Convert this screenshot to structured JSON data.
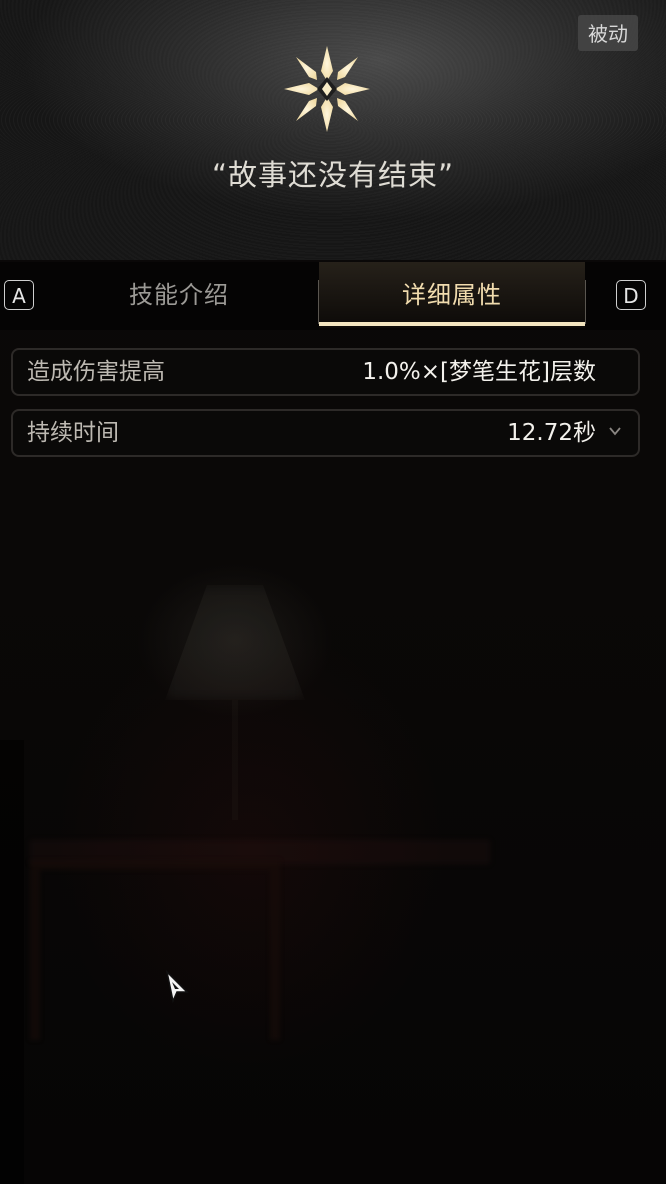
{
  "header": {
    "badge": "被动",
    "icon": "star-emblem-icon",
    "quote": "“故事还没有结束”"
  },
  "tabs": {
    "prev_key": "A",
    "next_key": "D",
    "items": [
      {
        "label": "技能介绍",
        "active": false
      },
      {
        "label": "详细属性",
        "active": true
      }
    ]
  },
  "attributes": [
    {
      "label": "造成伤害提高",
      "value": "1.0%×[梦笔生花]层数"
    },
    {
      "label": "持续时间",
      "value": "12.72秒",
      "expandable": true
    }
  ],
  "colors": {
    "accent": "#f2e4bf",
    "active_tab_text": "#f1dcae",
    "inactive_tab_text": "#9c9a96"
  }
}
